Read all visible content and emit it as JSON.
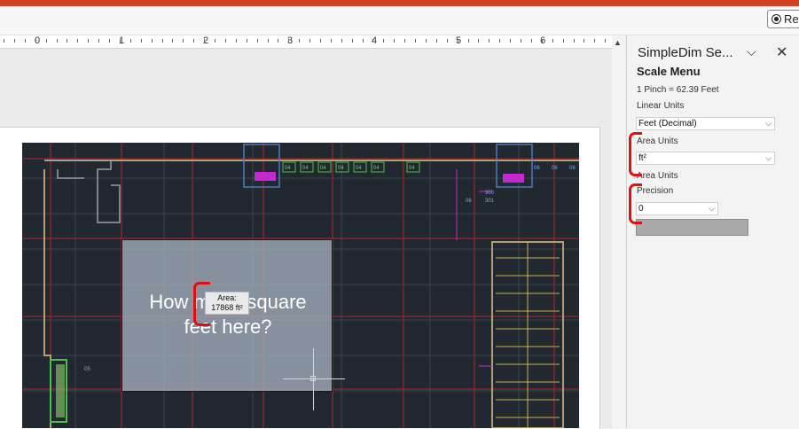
{
  "toolbar": {
    "record_label": "Re"
  },
  "ruler": {
    "numbers": [
      "0",
      "1",
      "2",
      "3",
      "4",
      "5",
      "6"
    ]
  },
  "canvas": {
    "question_line1": "How many square",
    "question_line2": "feet here?",
    "tooltip_line1": "Area:",
    "tooltip_line2": "17868 ft²",
    "plan_tags": [
      "04",
      "04",
      "04",
      "04",
      "04",
      "04",
      "04",
      "06",
      "06",
      "06",
      "05",
      "300",
      "301",
      "06"
    ]
  },
  "pane": {
    "title": "SimpleDim Se...",
    "section_title": "Scale Menu",
    "scale_text": "1 Pinch = 62.39 Feet",
    "linear_units_label": "Linear Units",
    "linear_units_value": "Feet (Decimal)",
    "area_units_label": "Area Units",
    "area_units_value": "ft²",
    "area_units_label2": "Area Units",
    "precision_label": "Precision",
    "precision_value": "0"
  },
  "colors": {
    "accent_bar": "#d04423",
    "highlight": "#e01010",
    "plan_bg": "#212830"
  },
  "icons": {
    "chevron": "chevron-down-icon",
    "close": "close-icon",
    "record": "radio-icon",
    "scroll": "scroll-up-icon"
  }
}
